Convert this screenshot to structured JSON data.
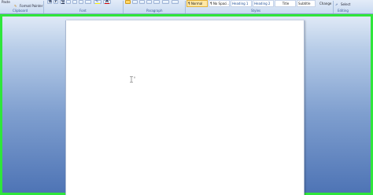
{
  "ribbon": {
    "clipboard": {
      "paste_label": "Paste",
      "format_painter_label": "Format Painter",
      "group_label": "Clipboard"
    },
    "font": {
      "bold": "B",
      "italic": "I",
      "underline": "U",
      "font_color": "A",
      "group_label": "Font"
    },
    "paragraph": {
      "group_label": "Paragraph"
    },
    "styles": {
      "items": [
        "¶ Normal",
        "¶ No Spaci...",
        "Heading 1",
        "Heading 2",
        "Title",
        "Subtitle"
      ],
      "change_styles_label": "Change Styles",
      "group_label": "Styles"
    },
    "editing": {
      "select_label": "Select",
      "group_label": "Editing"
    }
  },
  "colors": {
    "page": "#ffffff",
    "highlight_border": "#2fe63b",
    "selected_style": "#ffe8a6"
  }
}
